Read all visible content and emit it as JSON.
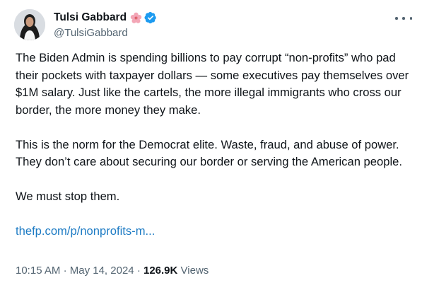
{
  "author": {
    "display_name": "Tulsi Gabbard",
    "emoji_icon": "hibiscus-icon",
    "verified_icon": "verified-badge-icon",
    "handle": "@TulsiGabbard"
  },
  "tweet": {
    "paragraph_1": "The Biden Admin is spending billions to pay corrupt “non-profits” who pad their pockets with taxpayer dollars — some executives pay themselves over $1M salary.  Just like the cartels, the more illegal immigrants who cross our border, the more money they make.",
    "paragraph_2": "This is the norm for the Democrat elite.  Waste, fraud, and abuse of power. They don’t care about securing our border or serving the American people.",
    "paragraph_3": "We must stop them.",
    "link_text": "thefp.com/p/nonprofits-m..."
  },
  "meta": {
    "time": "10:15 AM",
    "separator": "·",
    "date": "May 14, 2024",
    "views_count": "126.9K",
    "views_label": "Views"
  },
  "colors": {
    "text": "#0f1419",
    "secondary": "#536471",
    "link": "#1d7bc4",
    "verified": "#1d9bf0"
  }
}
